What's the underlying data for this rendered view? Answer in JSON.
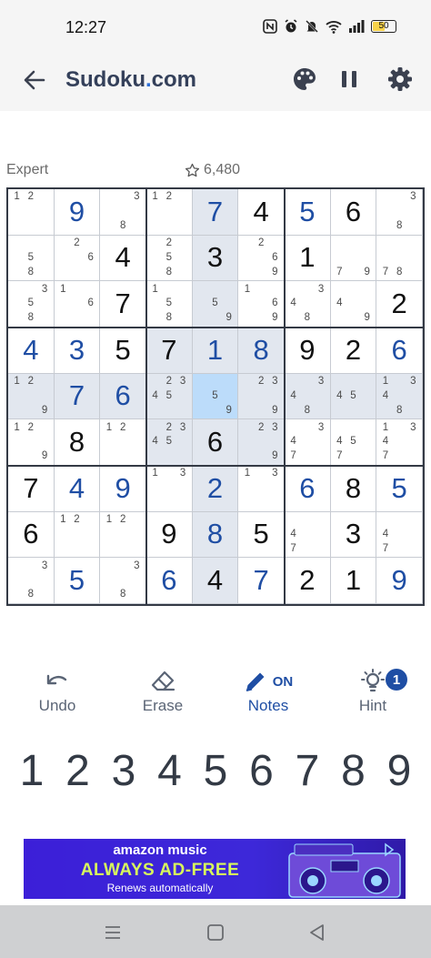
{
  "status_bar": {
    "time": "12:27",
    "battery": "50"
  },
  "app_bar": {
    "title_main": "Sudoku",
    "title_dot": ".",
    "title_tld": "com"
  },
  "meta": {
    "difficulty": "Expert",
    "score": "6,480"
  },
  "colors": {
    "accent": "#1f4ea4",
    "highlight": "#e2e7ef",
    "selected": "#bcdcfa",
    "ad_background": "#3c1fd8",
    "ad_headline": "#d8f85c"
  },
  "board": {
    "selected": [
      4,
      4
    ],
    "highlighted": [
      [
        3,
        3
      ],
      [
        3,
        4
      ],
      [
        3,
        5
      ],
      [
        4,
        3
      ],
      [
        4,
        5
      ],
      [
        5,
        3
      ],
      [
        5,
        4
      ],
      [
        5,
        5
      ],
      [
        0,
        4
      ],
      [
        1,
        4
      ],
      [
        2,
        4
      ],
      [
        6,
        4
      ],
      [
        7,
        4
      ],
      [
        8,
        4
      ],
      [
        4,
        0
      ],
      [
        4,
        1
      ],
      [
        4,
        2
      ],
      [
        4,
        6
      ],
      [
        4,
        7
      ],
      [
        4,
        8
      ]
    ],
    "rows": [
      [
        {
          "notes": [
            1,
            2
          ]
        },
        {
          "v": 9,
          "u": true
        },
        {
          "notes": [
            3,
            8
          ]
        },
        {
          "notes": [
            1,
            2
          ]
        },
        {
          "v": 7,
          "u": true
        },
        {
          "v": 4
        },
        {
          "v": 5,
          "u": true
        },
        {
          "v": 6
        },
        {
          "notes": [
            3,
            8
          ]
        }
      ],
      [
        {
          "notes": [
            5,
            8
          ]
        },
        {
          "notes": [
            2,
            6
          ]
        },
        {
          "v": 4
        },
        {
          "notes": [
            2,
            5,
            8
          ]
        },
        {
          "v": 3
        },
        {
          "notes": [
            2,
            6,
            9
          ]
        },
        {
          "v": 1
        },
        {
          "notes": [
            7,
            9
          ]
        },
        {
          "notes": [
            7,
            8
          ]
        }
      ],
      [
        {
          "notes": [
            3,
            5,
            8
          ]
        },
        {
          "notes": [
            1,
            6
          ]
        },
        {
          "v": 7
        },
        {
          "notes": [
            1,
            5,
            8
          ]
        },
        {
          "notes": [
            5,
            9
          ]
        },
        {
          "notes": [
            1,
            6,
            9
          ]
        },
        {
          "notes": [
            3,
            4,
            8
          ]
        },
        {
          "notes": [
            4,
            9
          ]
        },
        {
          "v": 2
        }
      ],
      [
        {
          "v": 4,
          "u": true
        },
        {
          "v": 3,
          "u": true
        },
        {
          "v": 5
        },
        {
          "v": 7
        },
        {
          "v": 1,
          "u": true
        },
        {
          "v": 8,
          "u": true
        },
        {
          "v": 9
        },
        {
          "v": 2
        },
        {
          "v": 6,
          "u": true
        }
      ],
      [
        {
          "notes": [
            1,
            2,
            9
          ]
        },
        {
          "v": 7,
          "u": true
        },
        {
          "v": 6,
          "u": true
        },
        {
          "notes": [
            2,
            3,
            4,
            5
          ]
        },
        {
          "notes": [
            5,
            9
          ]
        },
        {
          "notes": [
            2,
            3,
            9
          ]
        },
        {
          "notes": [
            3,
            4,
            8
          ]
        },
        {
          "notes": [
            4,
            5
          ]
        },
        {
          "notes": [
            1,
            3,
            4,
            8
          ]
        }
      ],
      [
        {
          "notes": [
            1,
            2,
            9
          ]
        },
        {
          "v": 8
        },
        {
          "notes": [
            1,
            2
          ]
        },
        {
          "notes": [
            2,
            3,
            4,
            5
          ]
        },
        {
          "v": 6
        },
        {
          "notes": [
            2,
            3,
            9
          ]
        },
        {
          "notes": [
            3,
            4,
            7
          ]
        },
        {
          "notes": [
            4,
            5,
            7
          ]
        },
        {
          "notes": [
            1,
            3,
            4,
            7
          ]
        }
      ],
      [
        {
          "v": 7
        },
        {
          "v": 4,
          "u": true
        },
        {
          "v": 9,
          "u": true
        },
        {
          "notes": [
            1,
            3
          ]
        },
        {
          "v": 2,
          "u": true
        },
        {
          "notes": [
            1,
            3
          ]
        },
        {
          "v": 6,
          "u": true
        },
        {
          "v": 8
        },
        {
          "v": 5,
          "u": true
        }
      ],
      [
        {
          "v": 6
        },
        {
          "notes": [
            1,
            2
          ]
        },
        {
          "notes": [
            1,
            2
          ]
        },
        {
          "v": 9
        },
        {
          "v": 8,
          "u": true
        },
        {
          "v": 5
        },
        {
          "notes": [
            4,
            7
          ]
        },
        {
          "v": 3
        },
        {
          "notes": [
            4,
            7
          ]
        }
      ],
      [
        {
          "notes": [
            3,
            8
          ]
        },
        {
          "v": 5,
          "u": true
        },
        {
          "notes": [
            3,
            8
          ]
        },
        {
          "v": 6,
          "u": true
        },
        {
          "v": 4
        },
        {
          "v": 7,
          "u": true
        },
        {
          "v": 2
        },
        {
          "v": 1
        },
        {
          "v": 9,
          "u": true
        }
      ]
    ]
  },
  "tools": {
    "undo": "Undo",
    "erase": "Erase",
    "notes": "Notes",
    "notes_state": "ON",
    "hint": "Hint",
    "hint_count": "1"
  },
  "numpad": [
    "1",
    "2",
    "3",
    "4",
    "5",
    "6",
    "7",
    "8",
    "9"
  ],
  "ad": {
    "brand": "amazon music",
    "headline": "ALWAYS AD-FREE",
    "subline": "Renews automatically"
  }
}
